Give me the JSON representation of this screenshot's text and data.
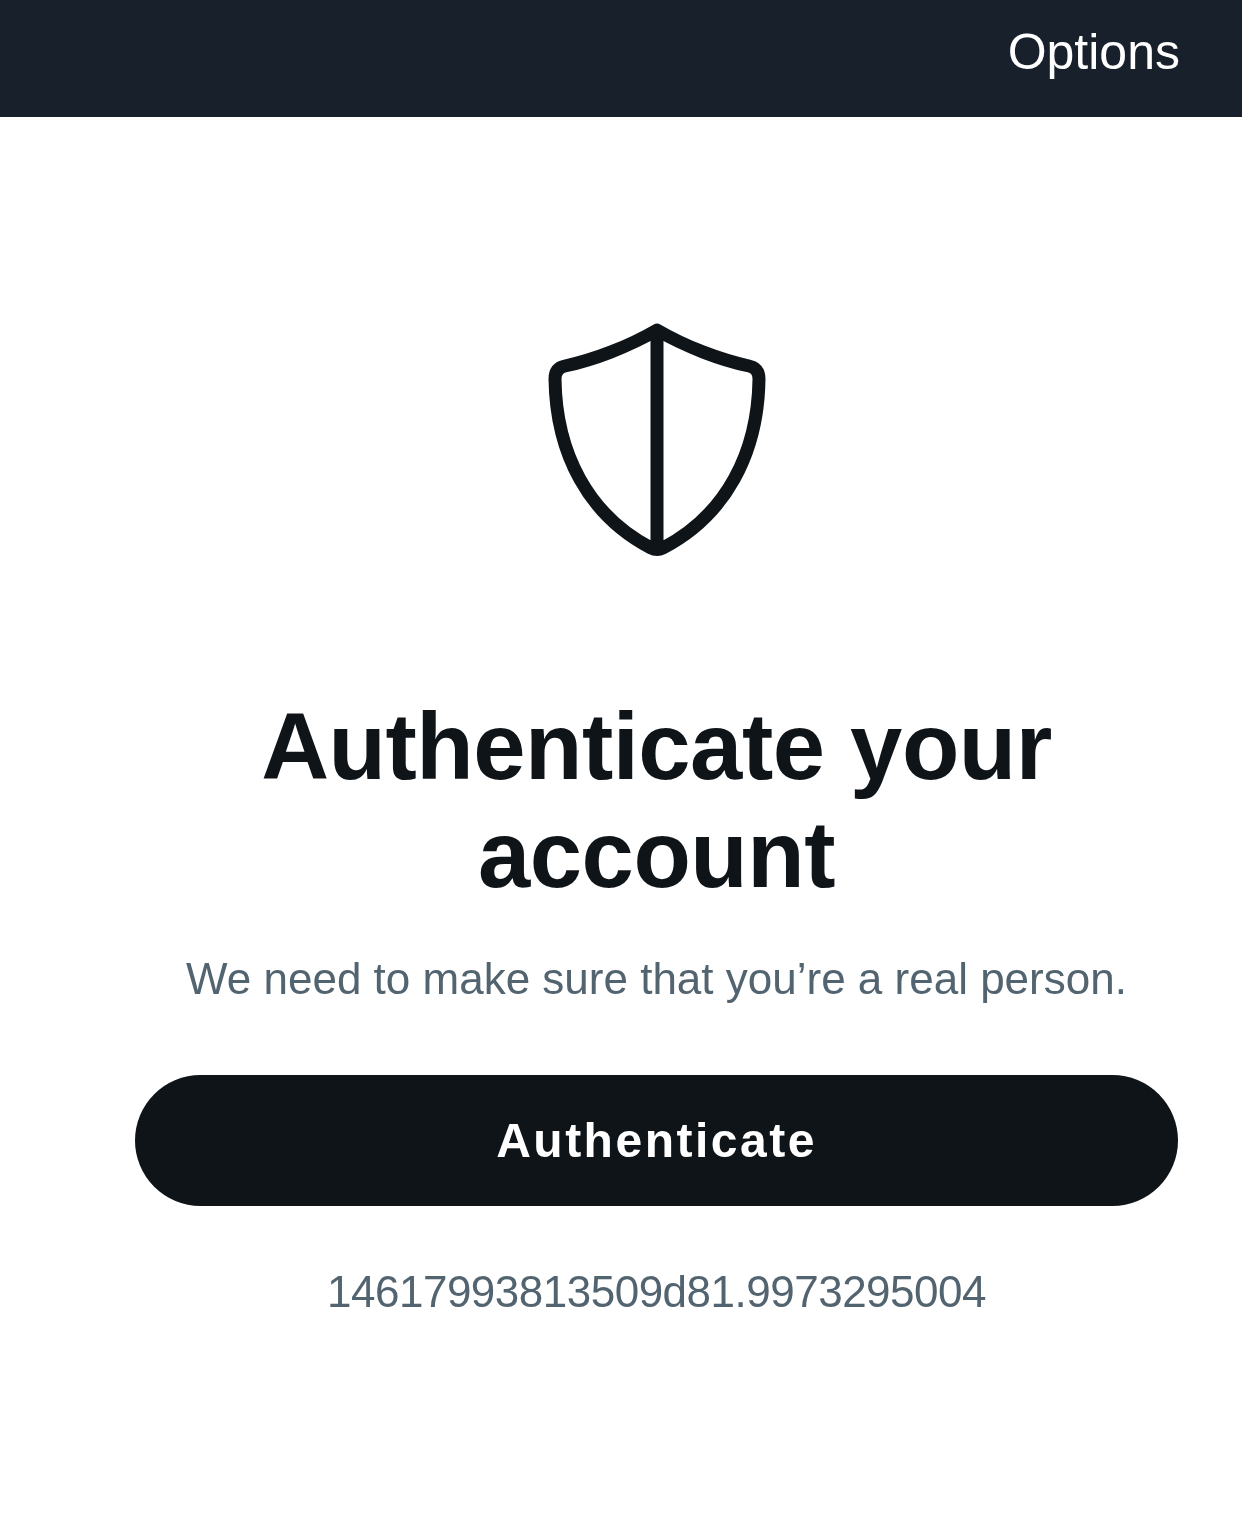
{
  "top_bar": {
    "options_label": "Options"
  },
  "title": "Authenticate your account",
  "subtitle": "We need to make sure that you’re a real person.",
  "primary_button": {
    "label": "Authenticate"
  },
  "reference_code": "14617993813509d81.9973295004"
}
